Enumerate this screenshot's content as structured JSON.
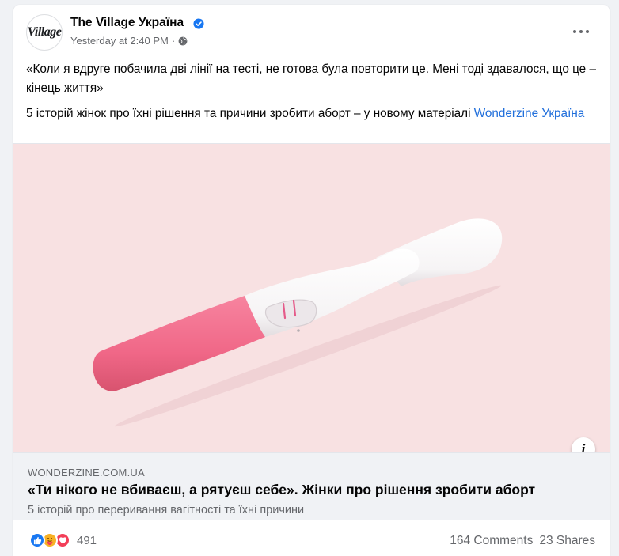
{
  "post": {
    "page_name": "The Village Україна",
    "avatar_text": "Village",
    "timestamp": "Yesterday at 2:40 PM",
    "separator": "·",
    "quote": "«Коли я вдруге побачила дві лінії на тесті, не готова була повторити це. Мені тоді здавалося, що це – кінець життя»",
    "body_prefix": "5 історій жінок про їхні рішення та причини зробити аборт – у новому матеріалі ",
    "body_link": "Wonderzine Україна"
  },
  "link_preview": {
    "domain": "WONDERZINE.COM.UA",
    "title": "«Ти нікого не вбиваєш, а рятуєш себе». Жінки про рішення зробити аборт",
    "description": "5 історій про переривання вагітності та їхні причини",
    "info_label": "i"
  },
  "engagement": {
    "reaction_count": "491",
    "comments": "164 Comments",
    "shares": "23 Shares",
    "reaction_icons": [
      "like-icon",
      "care-icon",
      "love-icon"
    ]
  },
  "colors": {
    "link": "#216fdb",
    "media_bg": "#f8e1e2",
    "test_pink": "#f06b8a",
    "test_white": "#ffffff"
  }
}
